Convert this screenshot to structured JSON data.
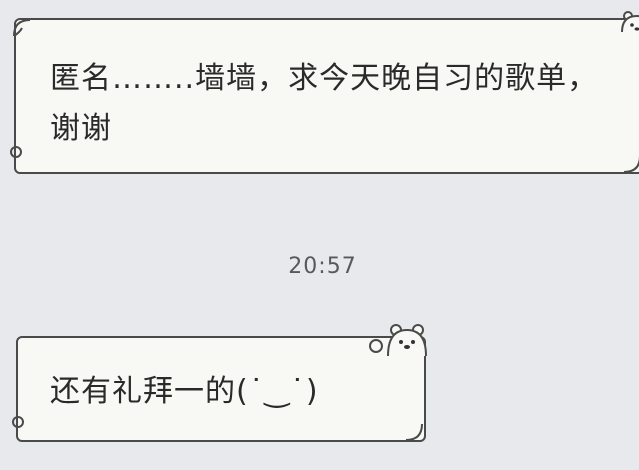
{
  "chat": {
    "messages": [
      {
        "text": "匿名……..墙墙，求今天晚自习的歌单，谢谢"
      },
      {
        "text": "还有礼拜一的(˙‿˙)"
      }
    ],
    "timestamp": "20:57"
  },
  "colors": {
    "background": "#e8e9ed",
    "bubble_fill": "#f8f9f5",
    "bubble_border": "#4a4a4a",
    "text": "#2a2a2a",
    "timestamp": "#555a5e"
  },
  "icons": [
    "bear-sticker-icon",
    "curl-corner-icon"
  ]
}
